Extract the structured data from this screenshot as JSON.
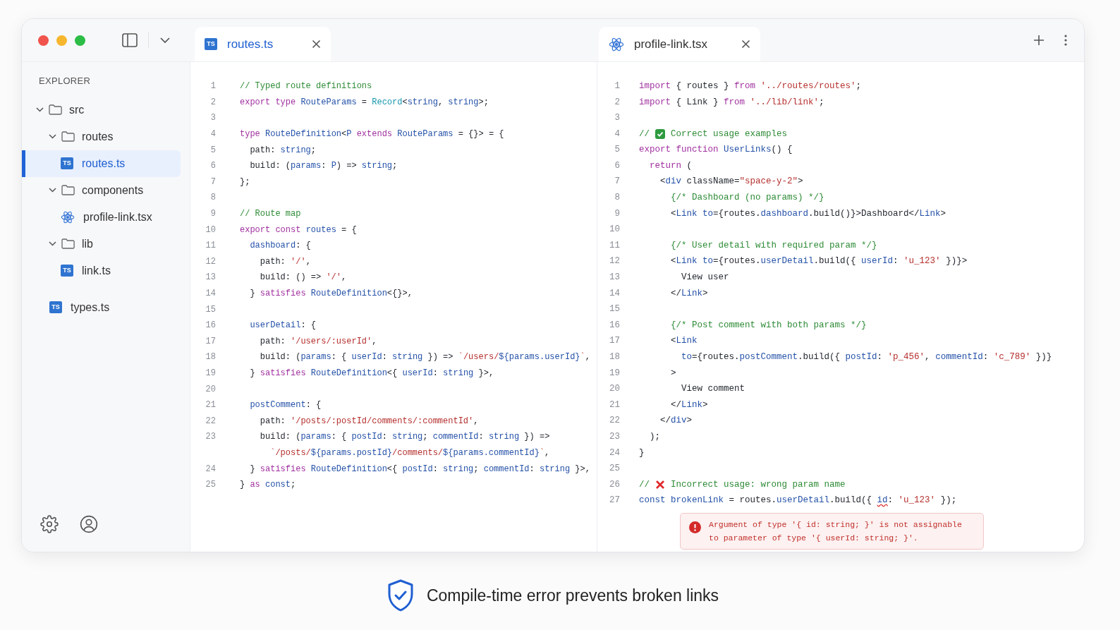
{
  "sidebar": {
    "title": "EXPLORER",
    "tree": [
      {
        "label": "src",
        "kind": "folder",
        "expanded": true,
        "selected": false,
        "children": [
          {
            "label": "routes",
            "kind": "folder",
            "expanded": true,
            "selected": false,
            "children": [
              {
                "label": "routes.ts",
                "kind": "ts",
                "badge": "TS",
                "selected": true
              }
            ]
          },
          {
            "label": "components",
            "kind": "folder",
            "expanded": true,
            "selected": false,
            "children": [
              {
                "label": "profile-link.tsx",
                "kind": "react",
                "selected": false
              }
            ]
          },
          {
            "label": "lib",
            "kind": "folder",
            "expanded": true,
            "selected": false,
            "children": [
              {
                "label": "link.ts",
                "kind": "ts",
                "badge": "TS",
                "selected": false
              }
            ]
          }
        ]
      },
      {
        "label": "types.ts",
        "kind": "ts",
        "badge": "TS",
        "selected": false
      }
    ]
  },
  "panes": [
    {
      "tab": {
        "label": "routes.ts",
        "kind": "ts",
        "badge": "TS",
        "selected": true
      },
      "lines": [
        {
          "n": "1",
          "tokens": [
            {
              "kind": "comment",
              "text": "// Typed route definitions"
            }
          ]
        },
        {
          "n": "2",
          "tokens": [
            {
              "kind": "keyword",
              "text": "export type "
            },
            {
              "kind": "type",
              "text": "RouteParams"
            },
            {
              "kind": "plain",
              "text": " = "
            },
            {
              "kind": "builtin",
              "text": "Record"
            },
            {
              "kind": "plain",
              "text": "<"
            },
            {
              "kind": "type",
              "text": "string"
            },
            {
              "kind": "plain",
              "text": ", "
            },
            {
              "kind": "type",
              "text": "string"
            },
            {
              "kind": "plain",
              "text": ">;"
            }
          ]
        },
        {
          "n": "3"
        },
        {
          "n": "4",
          "tokens": [
            {
              "kind": "keyword",
              "text": "type "
            },
            {
              "kind": "type",
              "text": "RouteDefinition"
            },
            {
              "kind": "plain",
              "text": "<"
            },
            {
              "kind": "type",
              "text": "P"
            },
            {
              "kind": "keyword",
              "text": " extends "
            },
            {
              "kind": "type",
              "text": "RouteParams"
            },
            {
              "kind": "plain",
              "text": " = {}> = {"
            }
          ]
        },
        {
          "n": "5",
          "tokens": [
            {
              "kind": "plain",
              "text": "  path: "
            },
            {
              "kind": "type",
              "text": "string"
            },
            {
              "kind": "plain",
              "text": ";"
            }
          ]
        },
        {
          "n": "6",
          "tokens": [
            {
              "kind": "plain",
              "text": "  build: ("
            },
            {
              "kind": "type",
              "text": "params"
            },
            {
              "kind": "plain",
              "text": ": "
            },
            {
              "kind": "type",
              "text": "P"
            },
            {
              "kind": "plain",
              "text": ") => "
            },
            {
              "kind": "type",
              "text": "string"
            },
            {
              "kind": "plain",
              "text": ";"
            }
          ]
        },
        {
          "n": "7",
          "tokens": [
            {
              "kind": "plain",
              "text": "};"
            }
          ]
        },
        {
          "n": "8"
        },
        {
          "n": "9",
          "tokens": [
            {
              "kind": "comment",
              "text": "// Route map"
            }
          ]
        },
        {
          "n": "10",
          "tokens": [
            {
              "kind": "keyword",
              "text": "export const "
            },
            {
              "kind": "type",
              "text": "routes"
            },
            {
              "kind": "plain",
              "text": " = {"
            }
          ]
        },
        {
          "n": "11",
          "tokens": [
            {
              "kind": "type",
              "text": "  dashboard"
            },
            {
              "kind": "plain",
              "text": ": {"
            }
          ]
        },
        {
          "n": "12",
          "tokens": [
            {
              "kind": "plain",
              "text": "    path: "
            },
            {
              "kind": "string",
              "text": "'/'"
            },
            {
              "kind": "plain",
              "text": ","
            }
          ]
        },
        {
          "n": "13",
          "tokens": [
            {
              "kind": "plain",
              "text": "    build: () => "
            },
            {
              "kind": "string",
              "text": "'/'"
            },
            {
              "kind": "plain",
              "text": ","
            }
          ]
        },
        {
          "n": "14",
          "tokens": [
            {
              "kind": "plain",
              "text": "  } "
            },
            {
              "kind": "keyword",
              "text": "satisfies "
            },
            {
              "kind": "type",
              "text": "RouteDefinition"
            },
            {
              "kind": "plain",
              "text": "<{}>,"
            }
          ]
        },
        {
          "n": "15"
        },
        {
          "n": "16",
          "tokens": [
            {
              "kind": "type",
              "text": "  userDetail"
            },
            {
              "kind": "plain",
              "text": ": {"
            }
          ]
        },
        {
          "n": "17",
          "tokens": [
            {
              "kind": "plain",
              "text": "    path: "
            },
            {
              "kind": "string",
              "text": "'/users/:userId'"
            },
            {
              "kind": "plain",
              "text": ","
            }
          ]
        },
        {
          "n": "18",
          "tokens": [
            {
              "kind": "plain",
              "text": "    build: ("
            },
            {
              "kind": "type",
              "text": "params"
            },
            {
              "kind": "plain",
              "text": ": { "
            },
            {
              "kind": "type",
              "text": "userId"
            },
            {
              "kind": "plain",
              "text": ": "
            },
            {
              "kind": "type",
              "text": "string"
            },
            {
              "kind": "plain",
              "text": " }) => "
            },
            {
              "kind": "string",
              "text": "`/users/"
            },
            {
              "kind": "type",
              "text": "${params.userId}"
            },
            {
              "kind": "string",
              "text": "`"
            },
            {
              "kind": "plain",
              "text": ","
            }
          ]
        },
        {
          "n": "19",
          "tokens": [
            {
              "kind": "plain",
              "text": "  } "
            },
            {
              "kind": "keyword",
              "text": "satisfies "
            },
            {
              "kind": "type",
              "text": "RouteDefinition"
            },
            {
              "kind": "plain",
              "text": "<{ "
            },
            {
              "kind": "type",
              "text": "userId"
            },
            {
              "kind": "plain",
              "text": ": "
            },
            {
              "kind": "type",
              "text": "string"
            },
            {
              "kind": "plain",
              "text": " }>,"
            }
          ]
        },
        {
          "n": "20"
        },
        {
          "n": "21",
          "tokens": [
            {
              "kind": "type",
              "text": "  postComment"
            },
            {
              "kind": "plain",
              "text": ": {"
            }
          ]
        },
        {
          "n": "22",
          "tokens": [
            {
              "kind": "plain",
              "text": "    path: "
            },
            {
              "kind": "string",
              "text": "'/posts/:postId/comments/:commentId'"
            },
            {
              "kind": "plain",
              "text": ","
            }
          ]
        },
        {
          "n": "23",
          "tokens": [
            {
              "kind": "plain",
              "text": "    build: ("
            },
            {
              "kind": "type",
              "text": "params"
            },
            {
              "kind": "plain",
              "text": ": { "
            },
            {
              "kind": "type",
              "text": "postId"
            },
            {
              "kind": "plain",
              "text": ": "
            },
            {
              "kind": "type",
              "text": "string"
            },
            {
              "kind": "plain",
              "text": "; "
            },
            {
              "kind": "type",
              "text": "commentId"
            },
            {
              "kind": "plain",
              "text": ": "
            },
            {
              "kind": "type",
              "text": "string"
            },
            {
              "kind": "plain",
              "text": " }) =>"
            }
          ]
        },
        {
          "tokens": [
            {
              "kind": "string",
              "text": "      `/posts/"
            },
            {
              "kind": "type",
              "text": "${params.postId}"
            },
            {
              "kind": "string",
              "text": "/comments/"
            },
            {
              "kind": "type",
              "text": "${params.commentId}"
            },
            {
              "kind": "string",
              "text": "`"
            },
            {
              "kind": "plain",
              "text": ","
            }
          ]
        },
        {
          "n": "24",
          "tokens": [
            {
              "kind": "plain",
              "text": "  } "
            },
            {
              "kind": "keyword",
              "text": "satisfies "
            },
            {
              "kind": "type",
              "text": "RouteDefinition"
            },
            {
              "kind": "plain",
              "text": "<{ "
            },
            {
              "kind": "type",
              "text": "postId"
            },
            {
              "kind": "plain",
              "text": ": "
            },
            {
              "kind": "type",
              "text": "string"
            },
            {
              "kind": "plain",
              "text": "; "
            },
            {
              "kind": "type",
              "text": "commentId"
            },
            {
              "kind": "plain",
              "text": ": "
            },
            {
              "kind": "type",
              "text": "string"
            },
            {
              "kind": "plain",
              "text": " }>,"
            }
          ]
        },
        {
          "n": "25",
          "tokens": [
            {
              "kind": "plain",
              "text": "} "
            },
            {
              "kind": "keyword",
              "text": "as "
            },
            {
              "kind": "type",
              "text": "const"
            },
            {
              "kind": "plain",
              "text": ";"
            }
          ]
        }
      ]
    },
    {
      "tab": {
        "label": "profile-link.tsx",
        "kind": "react",
        "selected": false
      },
      "lines": [
        {
          "n": "1",
          "tokens": [
            {
              "kind": "keyword",
              "text": "import "
            },
            {
              "kind": "plain",
              "text": "{ routes } "
            },
            {
              "kind": "keyword",
              "text": "from "
            },
            {
              "kind": "string",
              "text": "'../routes/routes'"
            },
            {
              "kind": "plain",
              "text": ";"
            }
          ]
        },
        {
          "n": "2",
          "tokens": [
            {
              "kind": "keyword",
              "text": "import "
            },
            {
              "kind": "plain",
              "text": "{ Link } "
            },
            {
              "kind": "keyword",
              "text": "from "
            },
            {
              "kind": "string",
              "text": "'../lib/link'"
            },
            {
              "kind": "plain",
              "text": ";"
            }
          ]
        },
        {
          "n": "3"
        },
        {
          "n": "4",
          "tokens": [
            {
              "kind": "comment",
              "text": "//"
            },
            {
              "kind": "check"
            },
            {
              "kind": "comment",
              "text": "Correct usage examples"
            }
          ]
        },
        {
          "n": "5",
          "tokens": [
            {
              "kind": "keyword",
              "text": "export function "
            },
            {
              "kind": "type",
              "text": "UserLinks"
            },
            {
              "kind": "plain",
              "text": "() {"
            }
          ]
        },
        {
          "n": "6",
          "tokens": [
            {
              "kind": "keyword",
              "text": "  return "
            },
            {
              "kind": "plain",
              "text": "("
            }
          ]
        },
        {
          "n": "7",
          "tokens": [
            {
              "kind": "plain",
              "text": "    <"
            },
            {
              "kind": "type",
              "text": "div"
            },
            {
              "kind": "plain",
              "text": " className="
            },
            {
              "kind": "string",
              "text": "\"space-y-2\""
            },
            {
              "kind": "plain",
              "text": ">"
            }
          ]
        },
        {
          "n": "8",
          "tokens": [
            {
              "kind": "comment",
              "text": "      {/* Dashboard (no params) */}"
            }
          ]
        },
        {
          "n": "9",
          "tokens": [
            {
              "kind": "plain",
              "text": "      <"
            },
            {
              "kind": "type",
              "text": "Link to"
            },
            {
              "kind": "plain",
              "text": "={routes."
            },
            {
              "kind": "type",
              "text": "dashboard"
            },
            {
              "kind": "plain",
              "text": ".build()}>Dashboard</"
            },
            {
              "kind": "type",
              "text": "Link"
            },
            {
              "kind": "plain",
              "text": ">"
            }
          ]
        },
        {
          "n": "10"
        },
        {
          "n": "11",
          "tokens": [
            {
              "kind": "comment",
              "text": "      {/* User detail with required param */}"
            }
          ]
        },
        {
          "n": "12",
          "tokens": [
            {
              "kind": "plain",
              "text": "      <"
            },
            {
              "kind": "type",
              "text": "Link to"
            },
            {
              "kind": "plain",
              "text": "={routes."
            },
            {
              "kind": "type",
              "text": "userDetail"
            },
            {
              "kind": "plain",
              "text": ".build({ "
            },
            {
              "kind": "type",
              "text": "userId"
            },
            {
              "kind": "plain",
              "text": ": "
            },
            {
              "kind": "string",
              "text": "'u_123'"
            },
            {
              "kind": "plain",
              "text": " })}>"
            }
          ]
        },
        {
          "n": "13",
          "tokens": [
            {
              "kind": "plain",
              "text": "        View user"
            }
          ]
        },
        {
          "n": "14",
          "tokens": [
            {
              "kind": "plain",
              "text": "      </"
            },
            {
              "kind": "type",
              "text": "Link"
            },
            {
              "kind": "plain",
              "text": ">"
            }
          ]
        },
        {
          "n": "15"
        },
        {
          "n": "16",
          "tokens": [
            {
              "kind": "comment",
              "text": "      {/* Post comment with both params */}"
            }
          ]
        },
        {
          "n": "17",
          "tokens": [
            {
              "kind": "plain",
              "text": "      <"
            },
            {
              "kind": "type",
              "text": "Link"
            }
          ]
        },
        {
          "n": "18",
          "tokens": [
            {
              "kind": "type",
              "text": "        to"
            },
            {
              "kind": "plain",
              "text": "={routes."
            },
            {
              "kind": "type",
              "text": "postComment"
            },
            {
              "kind": "plain",
              "text": ".build({ "
            },
            {
              "kind": "type",
              "text": "postId"
            },
            {
              "kind": "plain",
              "text": ": "
            },
            {
              "kind": "string",
              "text": "'p_456'"
            },
            {
              "kind": "plain",
              "text": ", "
            },
            {
              "kind": "type",
              "text": "commentId"
            },
            {
              "kind": "plain",
              "text": ": "
            },
            {
              "kind": "string",
              "text": "'c_789'"
            },
            {
              "kind": "plain",
              "text": " })}"
            }
          ]
        },
        {
          "n": "19",
          "tokens": [
            {
              "kind": "plain",
              "text": "      >"
            }
          ]
        },
        {
          "n": "20",
          "tokens": [
            {
              "kind": "plain",
              "text": "        View comment"
            }
          ]
        },
        {
          "n": "21",
          "tokens": [
            {
              "kind": "plain",
              "text": "      </"
            },
            {
              "kind": "type",
              "text": "Link"
            },
            {
              "kind": "plain",
              "text": ">"
            }
          ]
        },
        {
          "n": "22",
          "tokens": [
            {
              "kind": "plain",
              "text": "    </"
            },
            {
              "kind": "type",
              "text": "div"
            },
            {
              "kind": "plain",
              "text": ">"
            }
          ]
        },
        {
          "n": "23",
          "tokens": [
            {
              "kind": "plain",
              "text": "  );"
            }
          ]
        },
        {
          "n": "24",
          "tokens": [
            {
              "kind": "plain",
              "text": "}"
            }
          ]
        },
        {
          "n": "25"
        },
        {
          "n": "26",
          "tokens": [
            {
              "kind": "comment",
              "text": "//"
            },
            {
              "kind": "cross"
            },
            {
              "kind": "comment",
              "text": "Incorrect usage: wrong param name"
            }
          ]
        },
        {
          "n": "27",
          "tokens": [
            {
              "kind": "type",
              "text": "const brokenLink"
            },
            {
              "kind": "plain",
              "text": " = routes."
            },
            {
              "kind": "type",
              "text": "userDetail"
            },
            {
              "kind": "plain",
              "text": ".build({ "
            },
            {
              "kind": "error",
              "text": "id"
            },
            {
              "kind": "plain",
              "text": ": "
            },
            {
              "kind": "string",
              "text": "'u_123'"
            },
            {
              "kind": "plain",
              "text": " });"
            }
          ]
        }
      ],
      "diagnostic": {
        "kind": "error",
        "message": "Argument of type '{ id: string; }' is not assignable to parameter of type '{ userId: string; }'."
      }
    }
  ],
  "caption": "Compile-time error prevents broken links"
}
